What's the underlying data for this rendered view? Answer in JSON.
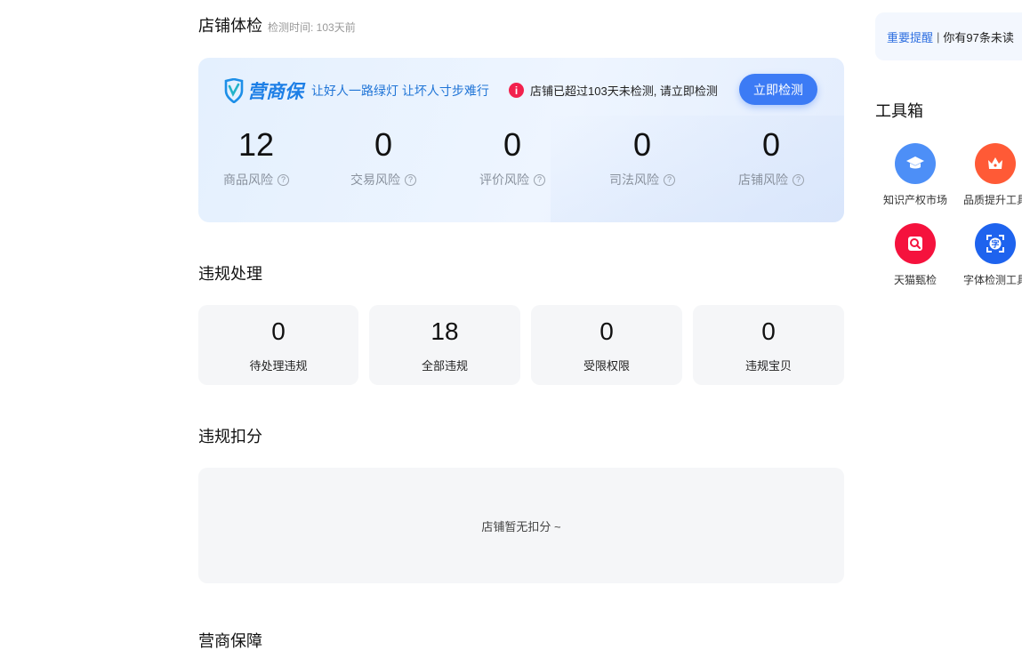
{
  "health": {
    "title": "店铺体检",
    "check_time": "检测时间: 103天前",
    "brand": "营商保",
    "slogan": "让好人一路绿灯 让坏人寸步难行",
    "alert_icon": "i",
    "alert": "店铺已超过103天未检测, 请立即检测",
    "check_button": "立即检测",
    "risks": [
      {
        "value": "12",
        "label": "商品风险"
      },
      {
        "value": "0",
        "label": "交易风险"
      },
      {
        "value": "0",
        "label": "评价风险"
      },
      {
        "value": "0",
        "label": "司法风险"
      },
      {
        "value": "0",
        "label": "店铺风险"
      }
    ]
  },
  "violations": {
    "title": "违规处理",
    "items": [
      {
        "value": "0",
        "label": "待处理违规"
      },
      {
        "value": "18",
        "label": "全部违规"
      },
      {
        "value": "0",
        "label": "受限权限"
      },
      {
        "value": "0",
        "label": "违规宝贝"
      }
    ]
  },
  "deduction": {
    "title": "违规扣分",
    "empty_text": "店铺暂无扣分 ~"
  },
  "guarantee": {
    "title": "营商保障"
  },
  "sidebar": {
    "notice_link": "重要提醒",
    "notice_sep": "|",
    "notice_text": "你有97条未读",
    "toolbox_title": "工具箱",
    "tools": [
      {
        "label": "知识产权市场",
        "icon": "graduation-cap-icon",
        "color": "#4d8ff7"
      },
      {
        "label": "品质提升工具",
        "icon": "crown-icon",
        "color": "#ff5a36"
      },
      {
        "label": "天猫甄检",
        "icon": "inspection-icon",
        "color": "#f5123d"
      },
      {
        "label": "字体检测工具",
        "icon": "font-scan-icon",
        "color": "#1e63ee"
      }
    ]
  }
}
